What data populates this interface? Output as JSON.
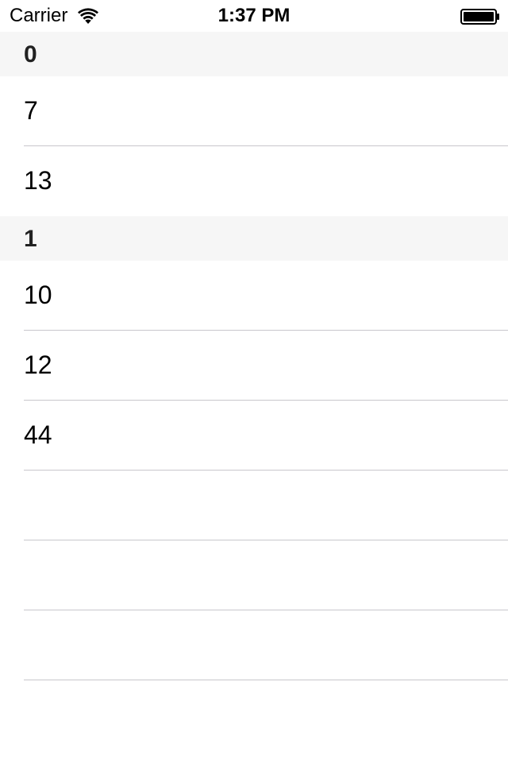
{
  "status_bar": {
    "carrier": "Carrier",
    "time": "1:37 PM",
    "wifi_icon": "wifi-icon",
    "battery_icon": "battery-icon"
  },
  "sections": [
    {
      "title": "0",
      "rows": [
        "7",
        "13"
      ]
    },
    {
      "title": "1",
      "rows": [
        "10",
        "12",
        "44"
      ]
    }
  ],
  "empty_rows": 3
}
